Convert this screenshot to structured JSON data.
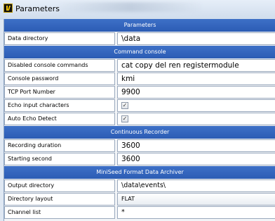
{
  "window": {
    "title": "Parameters"
  },
  "sections": {
    "parameters": "Parameters",
    "console": "Command console",
    "recorder": "Continuous Recorder",
    "archiver": "MiniSeed Format Data Archiver"
  },
  "fields": {
    "data_directory": {
      "label": "Data directory",
      "value": "\\data"
    },
    "disabled_commands": {
      "label": "Disabled console commands",
      "value": "cat copy del ren registermodule"
    },
    "console_password": {
      "label": "Console password",
      "value": "kmi"
    },
    "tcp_port": {
      "label": "TCP Port Number",
      "value": "9900"
    },
    "echo_input": {
      "label": "Echo input characters",
      "checked": true,
      "mark": "✓"
    },
    "auto_echo": {
      "label": "Auto Echo Detect",
      "checked": true,
      "mark": "✓"
    },
    "recording_duration": {
      "label": "Recording duration",
      "value": "3600"
    },
    "starting_second": {
      "label": "Starting second",
      "value": "3600"
    },
    "output_directory": {
      "label": "Output directory",
      "value": "\\data\\events\\"
    },
    "directory_layout": {
      "label": "Directory layout",
      "value": "FLAT"
    },
    "channel_list": {
      "label": "Channel list",
      "value": "*"
    }
  },
  "colors": {
    "section_bg": "#2f61b9",
    "app_icon": "#f5c400"
  },
  "icons": {
    "app": "kinemetrics-k-icon"
  }
}
